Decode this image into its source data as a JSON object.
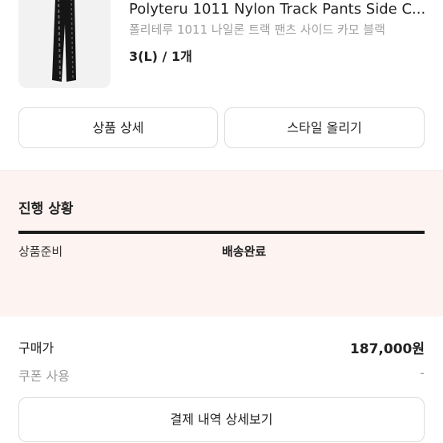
{
  "product": {
    "name": "Polyteru 1011 Nylon Track Pants Side C...",
    "subtitle": "폴리테루 1011 나일론 트랙 팬츠 사이드 카모 블랙",
    "option": "3(L) / 1개",
    "image_icon": "track-pants-thumbnail"
  },
  "actions": {
    "detail_label": "상품 상세",
    "style_label": "스타일 올리기"
  },
  "progress": {
    "title": "진행 상황",
    "steps": [
      "상품준비",
      "배송완료"
    ],
    "fill": 1.0
  },
  "payment": {
    "price_label": "구매가",
    "price_value": "187,000원",
    "coupon_label": "쿠폰 사용",
    "coupon_value": "-",
    "details_button": "결제 내역 상세보기"
  },
  "colors": {
    "progress_bg": "#fdf3f1",
    "progress_bar": "#1b1b1b",
    "muted_text": "#9a9a9a"
  }
}
